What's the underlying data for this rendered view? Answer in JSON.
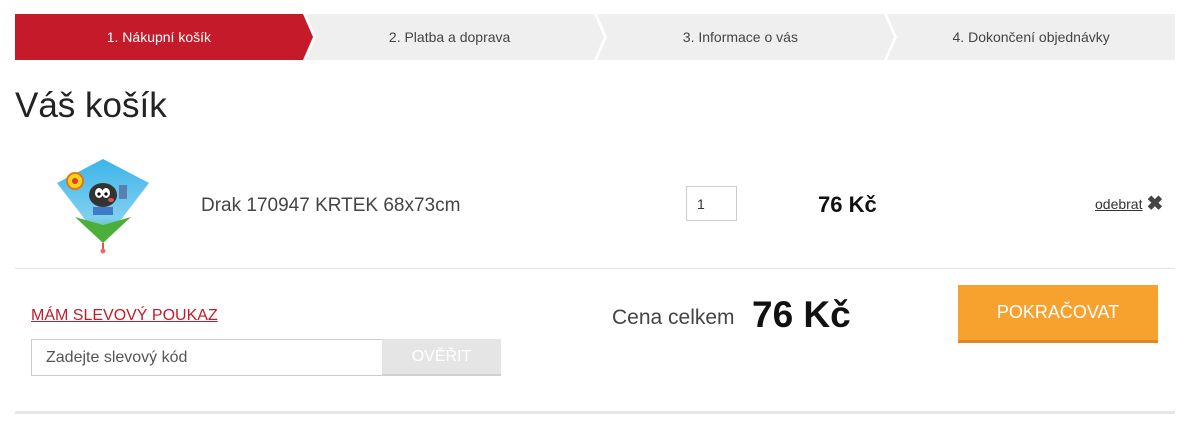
{
  "steps": [
    {
      "label": "1. Nákupní košík",
      "active": true
    },
    {
      "label": "2. Platba a doprava",
      "active": false
    },
    {
      "label": "3. Informace o vás",
      "active": false
    },
    {
      "label": "4. Dokončení objednávky",
      "active": false
    }
  ],
  "page_title": "Váš košík",
  "cart_item": {
    "image_icon": "kite-product-image",
    "name": "Drak 170947 KRTEK 68x73cm",
    "quantity": "1",
    "price": "76 Kč",
    "remove_label": "odebrat",
    "remove_icon": "✖"
  },
  "voucher": {
    "link_label": "MÁM SLEVOVÝ POUKAZ",
    "placeholder": "Zadejte slevový kód",
    "verify_label": "OVĚŘIT"
  },
  "summary": {
    "total_label": "Cena celkem",
    "total_value": "76 Kč",
    "continue_label": "POKRAČOVAT"
  },
  "colors": {
    "accent_red": "#c41a29",
    "continue_orange": "#f7a12f"
  }
}
